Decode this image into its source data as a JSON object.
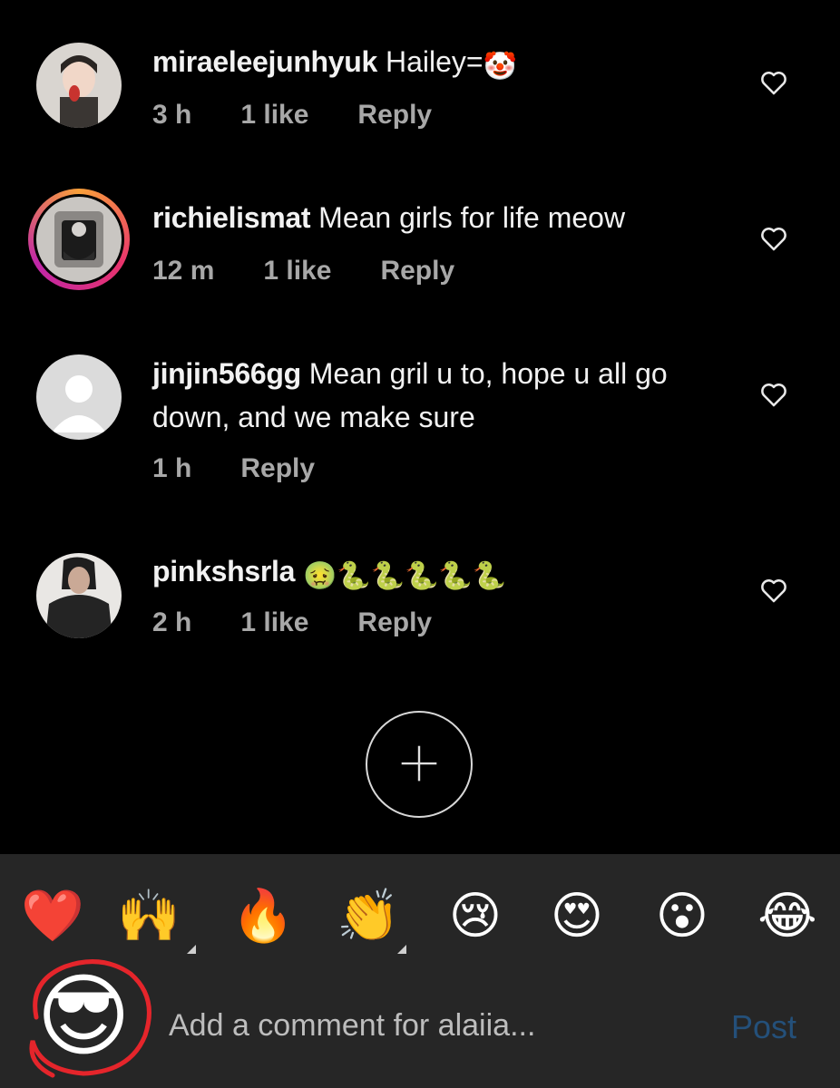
{
  "comments": [
    {
      "username": "miraeleejunhyuk",
      "text": "Hailey=",
      "emoji": "🤡",
      "time": "3 h",
      "likes": "1 like",
      "reply": "Reply"
    },
    {
      "username": "richielismat",
      "text": "Mean girls for life meow",
      "time": "12 m",
      "likes": "1 like",
      "reply": "Reply"
    },
    {
      "username": "jinjin566gg",
      "text": "Mean gril u to, hope u all go down, and we make sure",
      "time": "1 h",
      "reply": "Reply"
    },
    {
      "username": "pinkshsrla",
      "emoji": "🤢🐍🐍🐍🐍🐍",
      "time": "2 h",
      "likes": "1 like",
      "reply": "Reply"
    }
  ],
  "reactions": [
    "❤️",
    "🙌",
    "🔥",
    "👏",
    "😢",
    "😍",
    "😮",
    "😂"
  ],
  "self_avatar_emoji": "😎",
  "composer": {
    "placeholder": "Add a comment for alaiia...",
    "post_label": "Post"
  },
  "colors": {
    "background": "#000000",
    "panel": "#262626",
    "post": "#24507a",
    "secondary_text": "#a8a8a8"
  }
}
